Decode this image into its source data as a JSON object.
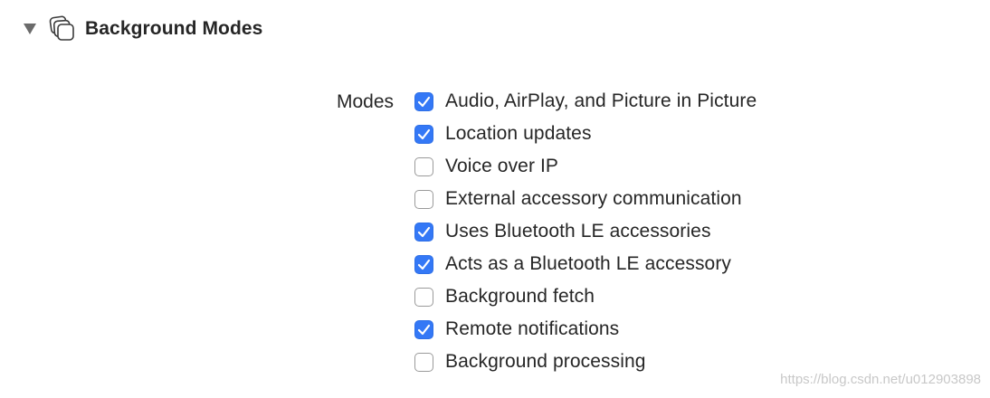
{
  "section": {
    "title": "Background Modes",
    "expanded": true,
    "icon": "stacked-layers-icon"
  },
  "modes": {
    "label": "Modes",
    "items": [
      {
        "label": "Audio, AirPlay, and Picture in Picture",
        "checked": true
      },
      {
        "label": "Location updates",
        "checked": true
      },
      {
        "label": "Voice over IP",
        "checked": false
      },
      {
        "label": "External accessory communication",
        "checked": false
      },
      {
        "label": "Uses Bluetooth LE accessories",
        "checked": true
      },
      {
        "label": "Acts as a Bluetooth LE accessory",
        "checked": true
      },
      {
        "label": "Background fetch",
        "checked": false
      },
      {
        "label": "Remote notifications",
        "checked": true
      },
      {
        "label": "Background processing",
        "checked": false
      }
    ]
  },
  "watermark": "https://blog.csdn.net/u012903898",
  "colors": {
    "checkbox_checked": "#3478f6",
    "checkbox_border": "#9a9a9a",
    "text": "#262626"
  }
}
